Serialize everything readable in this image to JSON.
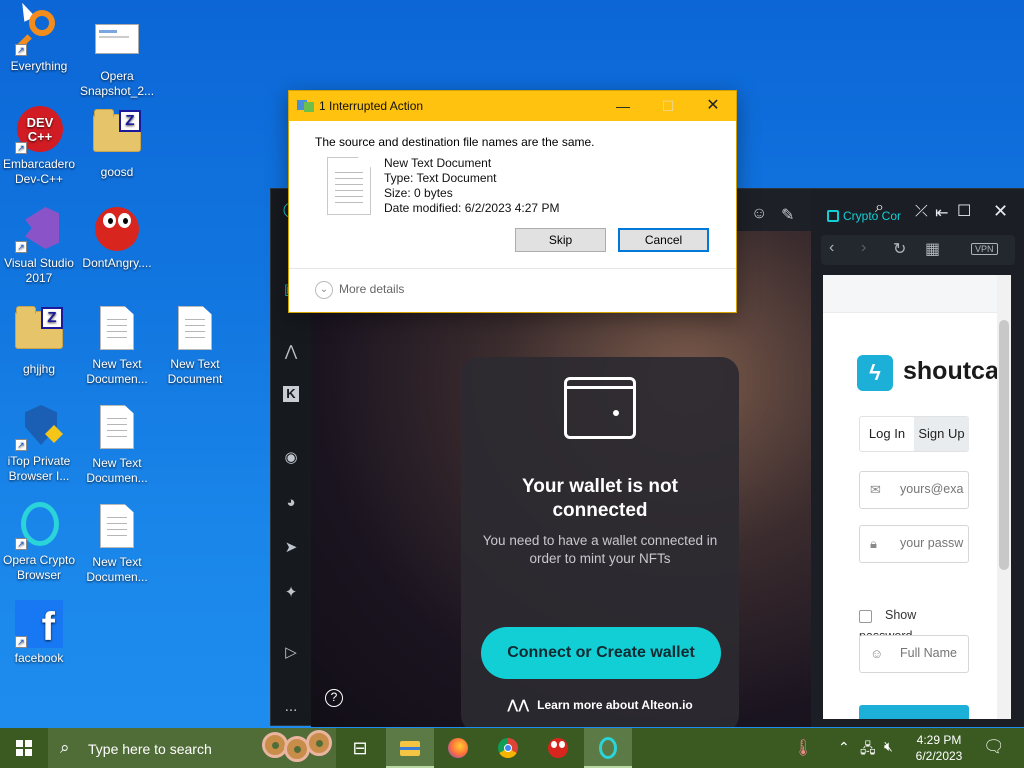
{
  "desktop": {
    "icons": [
      {
        "label": "Everything"
      },
      {
        "label": "Opera Snapshot_2..."
      },
      {
        "label": "Embarcadero Dev-C++"
      },
      {
        "label": "goosd"
      },
      {
        "label": "Visual Studio 2017"
      },
      {
        "label": "DontAngry...."
      },
      {
        "label": "ghjjhg"
      },
      {
        "label": "New Text Documen..."
      },
      {
        "label": "New Text Document"
      },
      {
        "label": "iTop Private Browser I..."
      },
      {
        "label": "New Text Documen..."
      },
      {
        "label": "Opera Crypto Browser"
      },
      {
        "label": "New Text Documen..."
      },
      {
        "label": "facebook"
      }
    ]
  },
  "dialog": {
    "title": "1 Interrupted Action",
    "message": "The source and destination file names are the same.",
    "file_name": "New Text Document",
    "file_type": "Type: Text Document",
    "file_size": "Size: 0 bytes",
    "file_modified": "Date modified: 6/2/2023 4:27 PM",
    "skip_label": "Skip",
    "cancel_label": "Cancel",
    "more_details_label": "More details"
  },
  "opera": {
    "wallet_title": "Your wallet is not connected",
    "wallet_subtitle": "You need to have a wallet connected in order to mint your NFTs",
    "connect_button": "Connect or Create wallet",
    "learn_more": "Learn more about Alteon.io",
    "help_glyph": "?",
    "more_glyph": "..."
  },
  "crypto_corner": {
    "title": "Crypto Cor",
    "vpn_label": "VPN",
    "brand_name": "shoutcas",
    "login_tab": "Log In",
    "signup_tab": "Sign Up",
    "email_placeholder": "yours@exa",
    "password_placeholder": "your passw",
    "show_password_1": "Show",
    "show_password_2": "password",
    "fullname_placeholder": "Full Name"
  },
  "taskbar": {
    "search_placeholder": "Type here to search",
    "time": "4:29 PM",
    "date": "6/2/2023"
  },
  "colors": {
    "dialog_title_bar": "#ffc20e",
    "wallet_button": "#12cfd6",
    "taskbar": "#3a5a22",
    "desktop": "#1277e0"
  }
}
